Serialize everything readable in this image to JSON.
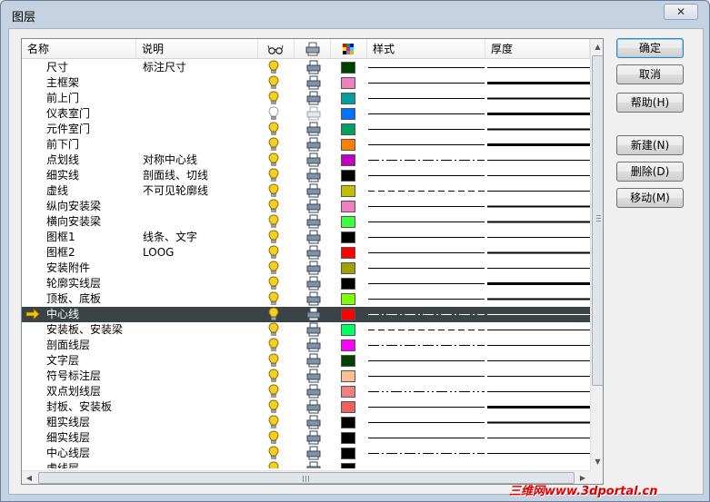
{
  "window": {
    "title": "图层",
    "close_label": "✕"
  },
  "columns": {
    "name": "名称",
    "desc": "说明",
    "style": "样式",
    "thickness": "厚度"
  },
  "rows": [
    {
      "name": "尺寸",
      "desc": "标注尺寸",
      "color": "#004000",
      "bulb": "on",
      "printer": "on",
      "style": "solid",
      "thick": 1
    },
    {
      "name": "主框架",
      "desc": "",
      "color": "#f080c0",
      "bulb": "on",
      "printer": "on",
      "style": "solid",
      "thick": 3
    },
    {
      "name": "前上门",
      "desc": "",
      "color": "#00a0a0",
      "bulb": "on",
      "printer": "on",
      "style": "solid",
      "thick": 2
    },
    {
      "name": "仪表室门",
      "desc": "",
      "color": "#0070ff",
      "bulb": "off",
      "printer": "off",
      "style": "solid",
      "thick": 3
    },
    {
      "name": "元件室门",
      "desc": "",
      "color": "#00a060",
      "bulb": "on",
      "printer": "on",
      "style": "solid",
      "thick": 2
    },
    {
      "name": "前下门",
      "desc": "",
      "color": "#ff8000",
      "bulb": "on",
      "printer": "on",
      "style": "solid",
      "thick": 3
    },
    {
      "name": "点划线",
      "desc": "对称中心线",
      "color": "#c000c0",
      "bulb": "on",
      "printer": "on",
      "style": "dashdot",
      "thick": 1
    },
    {
      "name": "细实线",
      "desc": "剖面线、切线",
      "color": "#000000",
      "bulb": "on",
      "printer": "on",
      "style": "solid",
      "thick": 1
    },
    {
      "name": "虚线",
      "desc": "不可见轮廓线",
      "color": "#c0c000",
      "bulb": "on",
      "printer": "on",
      "style": "dashed",
      "thick": 1
    },
    {
      "name": "纵向安装梁",
      "desc": "",
      "color": "#f080c0",
      "bulb": "on",
      "printer": "on",
      "style": "solid",
      "thick": 2
    },
    {
      "name": "横向安装梁",
      "desc": "",
      "color": "#40ff40",
      "bulb": "on",
      "printer": "on",
      "style": "solid",
      "thick": 2
    },
    {
      "name": "图框1",
      "desc": "线条、文字",
      "color": "#000000",
      "bulb": "on",
      "printer": "on",
      "style": "solid",
      "thick": 1
    },
    {
      "name": "图框2",
      "desc": "LOOG",
      "color": "#ff0000",
      "bulb": "on",
      "printer": "on",
      "style": "solid",
      "thick": 2
    },
    {
      "name": "安装附件",
      "desc": "",
      "color": "#a0a000",
      "bulb": "on",
      "printer": "on",
      "style": "solid",
      "thick": 1
    },
    {
      "name": "轮廓实线层",
      "desc": "",
      "color": "#000000",
      "bulb": "on",
      "printer": "on",
      "style": "solid",
      "thick": 3
    },
    {
      "name": "顶板、底板",
      "desc": "",
      "color": "#80ff00",
      "bulb": "on",
      "printer": "on",
      "style": "solid",
      "thick": 2
    },
    {
      "name": "中心线",
      "desc": "",
      "color": "#ff0000",
      "bulb": "on",
      "printer": "on",
      "style": "dashdot",
      "thick": 1,
      "selected": true
    },
    {
      "name": "安装板、安装梁",
      "desc": "",
      "color": "#00ff60",
      "bulb": "on",
      "printer": "on",
      "style": "dashed",
      "thick": 1
    },
    {
      "name": "剖面线层",
      "desc": "",
      "color": "#ff00ff",
      "bulb": "on",
      "printer": "on",
      "style": "dashdot",
      "thick": 1
    },
    {
      "name": "文字层",
      "desc": "",
      "color": "#004000",
      "bulb": "on",
      "printer": "on",
      "style": "solid",
      "thick": 1
    },
    {
      "name": "符号标注层",
      "desc": "",
      "color": "#ffc090",
      "bulb": "on",
      "printer": "on",
      "style": "solid",
      "thick": 1
    },
    {
      "name": "双点划线层",
      "desc": "",
      "color": "#f08080",
      "bulb": "on",
      "printer": "on",
      "style": "dashdotdot",
      "thick": 1
    },
    {
      "name": "封板、安装板",
      "desc": "",
      "color": "#f06060",
      "bulb": "on",
      "printer": "on",
      "style": "solid",
      "thick": 3
    },
    {
      "name": "粗实线层",
      "desc": "",
      "color": "#000000",
      "bulb": "on",
      "printer": "on",
      "style": "solid",
      "thick": 2
    },
    {
      "name": "细实线层",
      "desc": "",
      "color": "#000000",
      "bulb": "on",
      "printer": "on",
      "style": "solid",
      "thick": 1
    },
    {
      "name": "中心线层",
      "desc": "",
      "color": "#000000",
      "bulb": "on",
      "printer": "on",
      "style": "dashdot",
      "thick": 1
    },
    {
      "name": "虚线层",
      "desc": "",
      "color": "#000000",
      "bulb": "on",
      "printer": "on",
      "style": "dashed",
      "thick": 1
    }
  ],
  "buttons": {
    "ok": "确定",
    "cancel": "取消",
    "help": "帮助(H)",
    "new": "新建(N)",
    "delete": "删除(D)",
    "move": "移动(M)"
  },
  "watermark": "三维网www.3dportal.cn"
}
